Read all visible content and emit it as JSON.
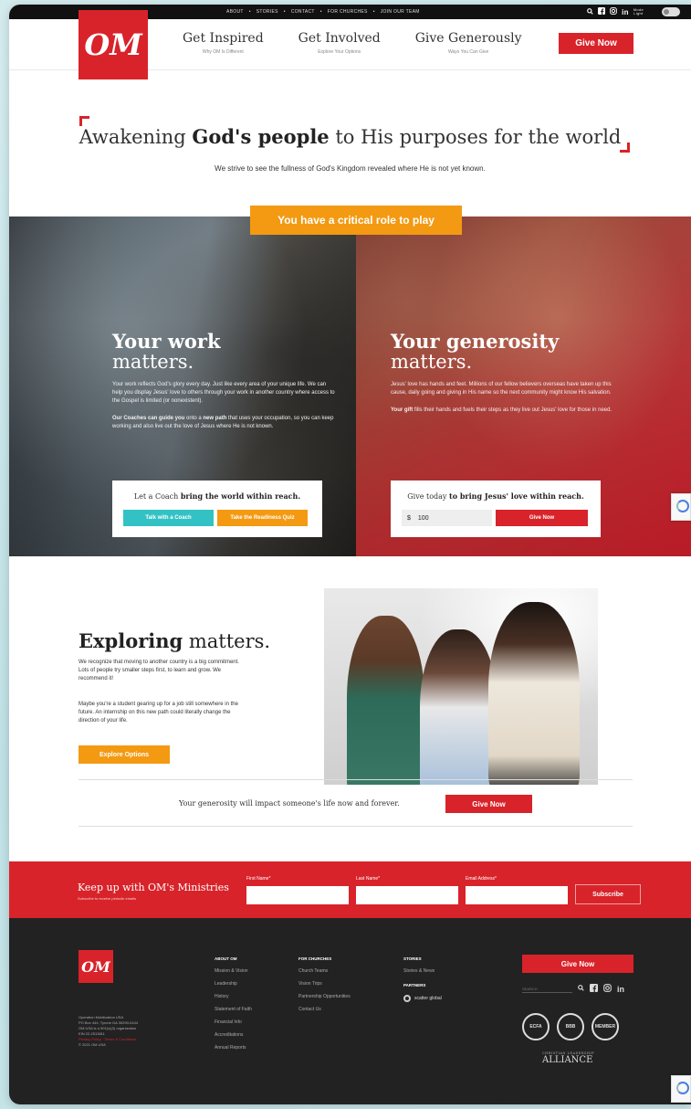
{
  "topbar": {
    "nav": [
      "ABOUT",
      "•",
      "STORIES",
      "•",
      "CONTACT",
      "•",
      "FOR CHURCHES",
      "•",
      "JOIN OUR TEAM"
    ],
    "toggle_label_1": "Mode",
    "toggle_label_2": "Light"
  },
  "header": {
    "logo": "OM",
    "nav": [
      {
        "title": "Get Inspired",
        "subtitle": "Why OM Is Different"
      },
      {
        "title": "Get Involved",
        "subtitle": "Explore Your Options"
      },
      {
        "title": "Give Generously",
        "subtitle": "Ways You Can Give"
      }
    ],
    "give_button": "Give Now"
  },
  "hero": {
    "title_1": "Awakening ",
    "title_bold": "God's people",
    "title_2": " to His purposes for the world",
    "subtitle": "We strive to see the fullness of God's Kingdom revealed where He is not yet known."
  },
  "role_banner": "You have a critical role to play",
  "work": {
    "heading_bold": "Your work",
    "heading_light": "matters.",
    "p1": "Your work reflects God's glory every day. Just like every area of your unique life. We can help you display Jesus' love to others through your work in another country where access to the Gospel is limited (or nonexistent).",
    "p2_bold": "Our Coaches can guide you",
    "p2_a": " onto a ",
    "p2_bold2": "new path",
    "p2_b": " that uses your occupation, so you can keep working and also live out the love of Jesus where He is not known.",
    "card_a": "Let a Coach ",
    "card_bold": "bring the world within reach.",
    "btn_coach": "Talk with a Coach",
    "btn_quiz": "Take the Readiness Quiz"
  },
  "generosity": {
    "heading_bold": "Your generosity",
    "heading_light": "matters.",
    "p1": "Jesus' love has hands and feet. Millions of our fellow believers overseas have taken up this cause, daily going and giving in His name so the next community might know His salvation.",
    "p2_bold": "Your gift",
    "p2": " fills their hands and fuels their steps as they live out Jesus' love for those in need.",
    "card_a": "Give today ",
    "card_bold": "to bring Jesus' love within reach.",
    "currency": "$",
    "amount": "100",
    "btn_give": "Give Now"
  },
  "explore": {
    "heading_bold": "Exploring",
    "heading_light": " matters.",
    "p1": "We recognize that moving to another country is a big commitment. Lots of people try smaller steps first, to learn and grow. We recommend it!",
    "p2": "Maybe you're a student gearing up for a job still somewhere in the future. An internship on this new path could literally change the direction of your life.",
    "button": "Explore Options"
  },
  "generosity_strip": {
    "text": "Your generosity will impact someone's life now and forever.",
    "button": "Give Now"
  },
  "newsletter": {
    "title": "Keep up with OM's Ministries",
    "subtitle": "Subscribe to receive periodic emails",
    "first_name": "First Name*",
    "last_name": "Last Name*",
    "email": "Email Address*",
    "button": "Subscribe"
  },
  "footer": {
    "logo": "OM",
    "address": [
      "Operation Mobilization USA",
      "PO Box 444, Tyrone GA 30290-0444",
      "OM USA is a 501(c)(3) organization",
      "EIN 22-2513811"
    ],
    "links_line": "Privacy Policy · Terms & Conditions",
    "copyright": "© 2021 OM USA",
    "col1": {
      "head": "ABOUT OM",
      "items": [
        "Mission & Vision",
        "Leadership",
        "History",
        "Statement of Faith",
        "Financial Info",
        "Accreditations",
        "Annual Reports"
      ]
    },
    "col2": {
      "head": "FOR CHURCHES",
      "items": [
        "Church Teams",
        "Vision Trips",
        "Partnership Opportunities",
        "Contact Us"
      ]
    },
    "col3": {
      "head": "STORIES",
      "items": [
        "Stories & News"
      ],
      "partners_head": "PARTNERS",
      "partner": "scatter global"
    },
    "give_button": "Give Now",
    "search_placeholder": "SEARCH",
    "seals": [
      "ECFA",
      "BBB",
      "MEMBER"
    ],
    "alliance_small": "CHRISTIAN LEADERSHIP",
    "alliance": "ALLIANCE"
  }
}
